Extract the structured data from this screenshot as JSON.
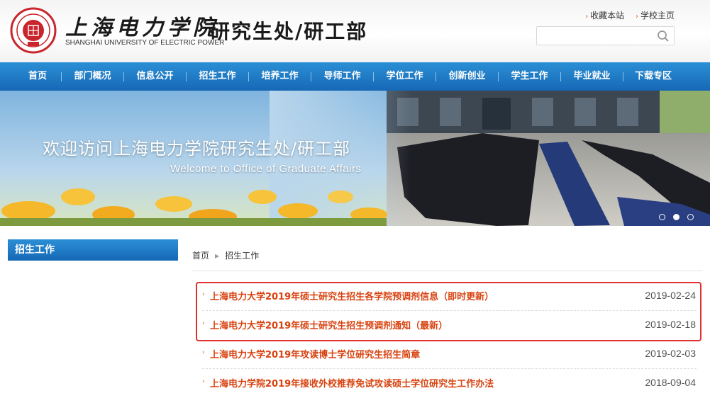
{
  "header": {
    "school_cn": "上海电力学院",
    "school_en": "SHANGHAI UNIVERSITY OF ELECTRIC POWER",
    "dept_title": "研究生处/研工部",
    "links": [
      "收藏本站",
      "学校主页"
    ],
    "search_placeholder": ""
  },
  "nav": {
    "items": [
      "首页",
      "部门概况",
      "信息公开",
      "招生工作",
      "培养工作",
      "导师工作",
      "学位工作",
      "创新创业",
      "学生工作",
      "毕业就业",
      "下载专区"
    ]
  },
  "banner": {
    "title_cn": "欢迎访问上海电力学院研究生处/研工部",
    "title_en": "Welcome to Office of Graduate Affairs",
    "slide_count": 3,
    "active_slide": 2
  },
  "sidebar": {
    "title": "招生工作"
  },
  "breadcrumb": {
    "home": "首页",
    "current": "招生工作"
  },
  "articles": [
    {
      "title": "上海电力大学2019年硕士研究生招生各学院预调剂信息（即时更新）",
      "date": "2019-02-24"
    },
    {
      "title": "上海电力大学2019年硕士研究生招生预调剂通知（最新）",
      "date": "2019-02-18"
    },
    {
      "title": "上海电力大学2019年攻读博士学位研究生招生简章",
      "date": "2019-02-03"
    },
    {
      "title": "上海电力学院2019年接收外校推荐免试攻读硕士学位研究生工作办法",
      "date": "2018-09-04"
    }
  ],
  "colors": {
    "nav_blue": "#1f7cc7",
    "title_orange": "#d8420f",
    "highlight_red": "#e03030"
  }
}
